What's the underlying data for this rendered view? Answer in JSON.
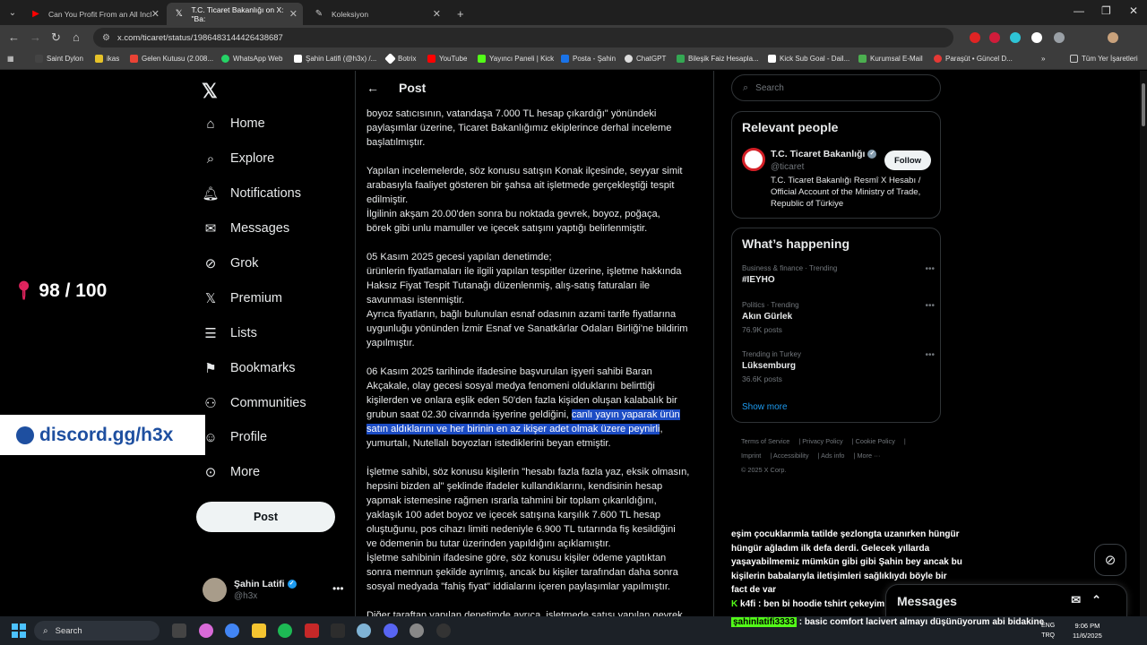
{
  "browser": {
    "tabs": [
      {
        "label": "Can You Profit From an All Incl"
      },
      {
        "label": "T.C. Ticaret Bakanlığı on X: \"Ba:"
      },
      {
        "label": "Koleksiyon"
      }
    ],
    "url": "x.com/ticaret/status/1986483144426438687",
    "bookmarks": [
      "Saint Dylon",
      "ikas",
      "Gelen Kutusu (2.008...",
      "WhatsApp Web",
      "Şahin Latifi (@h3x) /...",
      "Botrix",
      "YouTube",
      "Yayıncı Paneli | Kick",
      "Posta - Şahin",
      "ChatGPT",
      "Bileşik Faiz Hesapla...",
      "Kick Sub Goal - Dail...",
      "Kurumsal E-Mail",
      "Paraşüt • Güncel D..."
    ],
    "all_bookmarks": "Tüm Yer İşaretleri"
  },
  "overlays": {
    "counter": "98 / 100",
    "discord": "discord.gg/h3x"
  },
  "nav": {
    "items": [
      "Home",
      "Explore",
      "Notifications",
      "Messages",
      "Grok",
      "Premium",
      "Lists",
      "Bookmarks",
      "Communities",
      "Profile",
      "More"
    ],
    "post_button": "Post",
    "account_name": "Şahin Latifi",
    "account_handle": "@h3x"
  },
  "column": {
    "title": "Post",
    "paragraphs": [
      "boyoz satıcısının, vatandaşa 7.000 TL hesap çıkardığı\" yönündeki\npaylaşımlar üzerine, Ticaret Bakanlığımız ekiplerince derhal inceleme\nbaşlatılmıştır.",
      "Yapılan incelemelerde, söz konusu satışın Konak ilçesinde, seyyar simit\narabasıyla faaliyet gösteren bir şahsa ait işletmede gerçekleştiği tespit\nedilmiştir.\nİlgilinin akşam 20.00'den sonra bu noktada gevrek, boyoz, poğaça,\nbörek gibi unlu mamuller ve içecek satışını yaptığı belirlenmiştir.",
      "05 Kasım 2025 gecesi yapılan denetimde;\nürünlerin fiyatlamaları ile ilgili yapılan tespitler üzerine, işletme hakkında\nHaksız Fiyat Tespit Tutanağı düzenlenmiş, alış-satış faturaları ile\nsavunması istenmiştir.\nAyrıca fiyatların, bağlı bulunulan esnaf odasının azami tarife fiyatlarına\nuygunluğu yönünden İzmir Esnaf ve Sanatkârlar Odaları Birliği'ne bildirim\nyapılmıştır."
    ],
    "p4_before": "06 Kasım 2025 tarihinde ifadesine başvurulan işyeri sahibi Baran\nAkçakale, olay gecesi sosyal medya fenomeni olduklarını belirttiği\nkişilerden ve onlara eşlik eden 50'den fazla kişiden oluşan kalabalık bir\ngrubun saat 02.30 civarında işyerine geldiğini, ",
    "p4_highlight": "canlı yayın yaparak ürün\nsatın aldıklarını ve her birinin en az ikişer adet olmak üzere peynirli",
    "p4_after": ",\nyumurtalı, Nutellalı boyozları istediklerini beyan etmiştir.",
    "p5": "İşletme sahibi, söz konusu kişilerin \"hesabı fazla fazla yaz, eksik olmasın,\nhepsini bizden al\" şeklinde ifadeler kullandıklarını, kendisinin hesap\nyapmak istemesine rağmen ısrarla tahmini bir toplam çıkarıldığını,\nyaklaşık 100 adet boyoz ve içecek satışına karşılık 7.600 TL hesap\noluştuğunu, pos cihazı limiti nedeniyle 6.900 TL tutarında fiş kesildiğini\nve ödemenin bu tutar üzerinden yapıldığını açıklamıştır.\nİşletme sahibinin ifadesine göre, söz konusu kişiler ödeme yaptıktan\nsonra memnun şekilde ayrılmış, ancak bu kişiler tarafından daha sonra\nsosyal medyada \"fahiş fiyat\" iddialarını içeren paylaşımlar yapılmıştır.",
    "p6": "Diğer taraftan yapılan denetimde ayrıca, işletmede satışı yapılan gevrek,"
  },
  "sidebar": {
    "search_placeholder": "Search",
    "relevant_title": "Relevant people",
    "rp_name": "T.C. Ticaret Bakanlığı",
    "rp_handle": "@ticaret",
    "rp_follow": "Follow",
    "rp_bio": "T.C. Ticaret Bakanlığı Resmî X Hesabı / Official Account of the Ministry of Trade, Republic of Türkiye",
    "happening_title": "What’s happening",
    "trends": [
      {
        "meta": "Business & finance · Trending",
        "name": "#IEYHO",
        "posts": ""
      },
      {
        "meta": "Politics · Trending",
        "name": "Akın Gürlek",
        "posts": "76.9K posts"
      },
      {
        "meta": "Trending in Turkey",
        "name": "Lüksemburg",
        "posts": "36.6K posts"
      }
    ],
    "show_more": "Show more",
    "footer": [
      "Terms of Service",
      "Privacy Policy",
      "Cookie Policy",
      "Imprint",
      "Accessibility",
      "Ads info",
      "More ···",
      "© 2025 X Corp."
    ]
  },
  "chat": {
    "message": "eşim çocuklarımla tatilde şezlongta uzanırken hüngür hüngür ağladım ilk defa derdi. Gelecek yıllarda yaşayabilmemiz mümkün gibi gibi Şahin bey ancak bu kişilerin babalarıyla iletişimleri sağlıklıydı böyle bir fact de var",
    "line2_user": "k4fi",
    "line2_text": "ben bi hoodie tshirt çekeyim",
    "line3_user": "şahinlatifi3333",
    "line3_text": "basic comfort lacivert almayı düşünüyorum abi bidakine"
  },
  "messages_drawer": "Messages",
  "taskbar": {
    "search": "Search",
    "lang1": "ENG",
    "lang2": "TRQ",
    "time": "9:06 PM",
    "date": "11/6/2025"
  }
}
